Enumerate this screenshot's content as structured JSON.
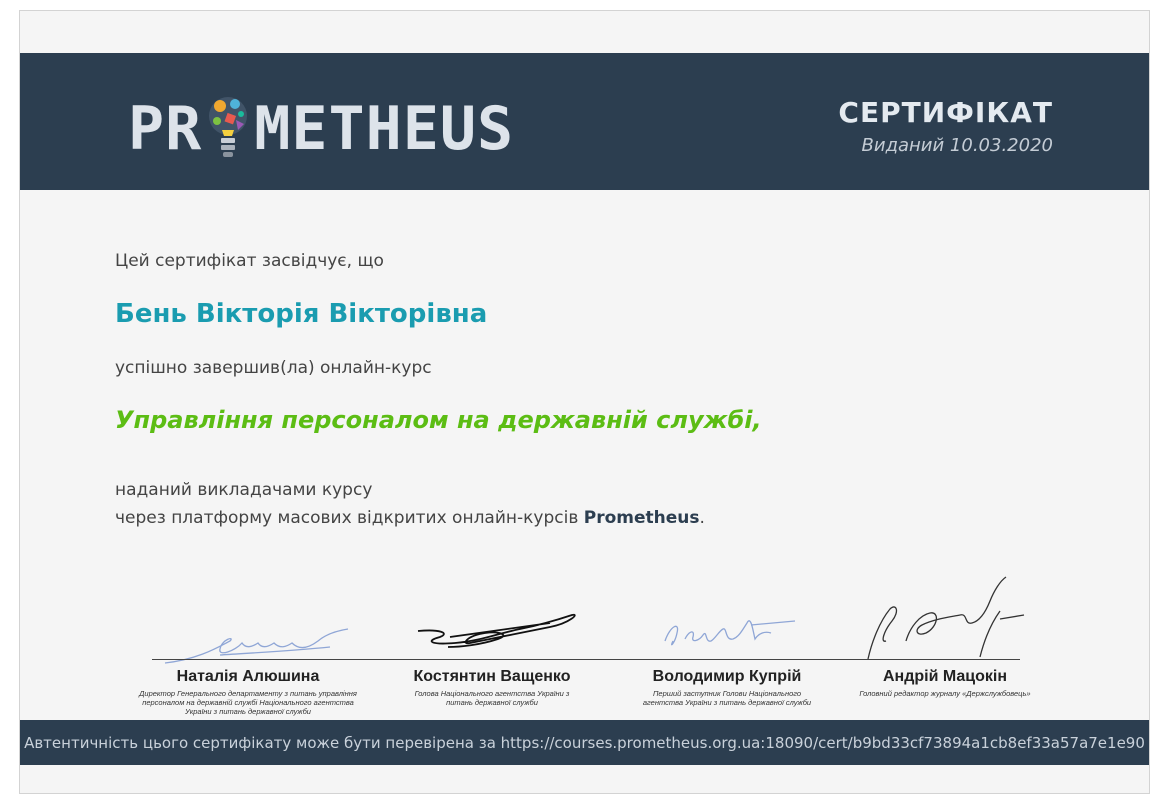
{
  "header": {
    "logo_left": "PR",
    "logo_right": "METHEUS",
    "cert_title": "СЕРТИФІКАТ",
    "issued": "Виданий 10.03.2020"
  },
  "content": {
    "intro": "Цей сертифікат засвідчує, що",
    "recipient": "Бень Вікторія Вікторівна",
    "completed": "успішно завершив(ла) онлайн-курс",
    "course": "Управління персоналом на державній службі,",
    "given_by": "наданий викладачами курсу",
    "via": "через платформу масових відкритих онлайн-курсів",
    "platform": "Prometheus",
    "dot": "."
  },
  "signers": [
    {
      "name": "Наталія Алюшина",
      "role": "Директор Генерального департаменту з питань управління персоналом на державній службі Національного агентства України з питань державної служби"
    },
    {
      "name": "Костянтин Ващенко",
      "role": "Голова Національного агентства України з питань державної служби"
    },
    {
      "name": "Володимир Купрій",
      "role": "Перший заступник Голови Національного агентства України з питань державної служби"
    },
    {
      "name": "Андрій Мацокін",
      "role": "Головний редактор журналу «Держслужбовець»"
    }
  ],
  "footer": {
    "text": "Автентичність цього сертифікату може бути перевірена за https://courses.prometheus.org.ua:18090/cert/b9bd33cf73894a1cb8ef33a57a7e1e90"
  },
  "colors": {
    "header_bg": "#2c3e50",
    "name": "#1a9cb0",
    "course": "#5cbd14"
  }
}
